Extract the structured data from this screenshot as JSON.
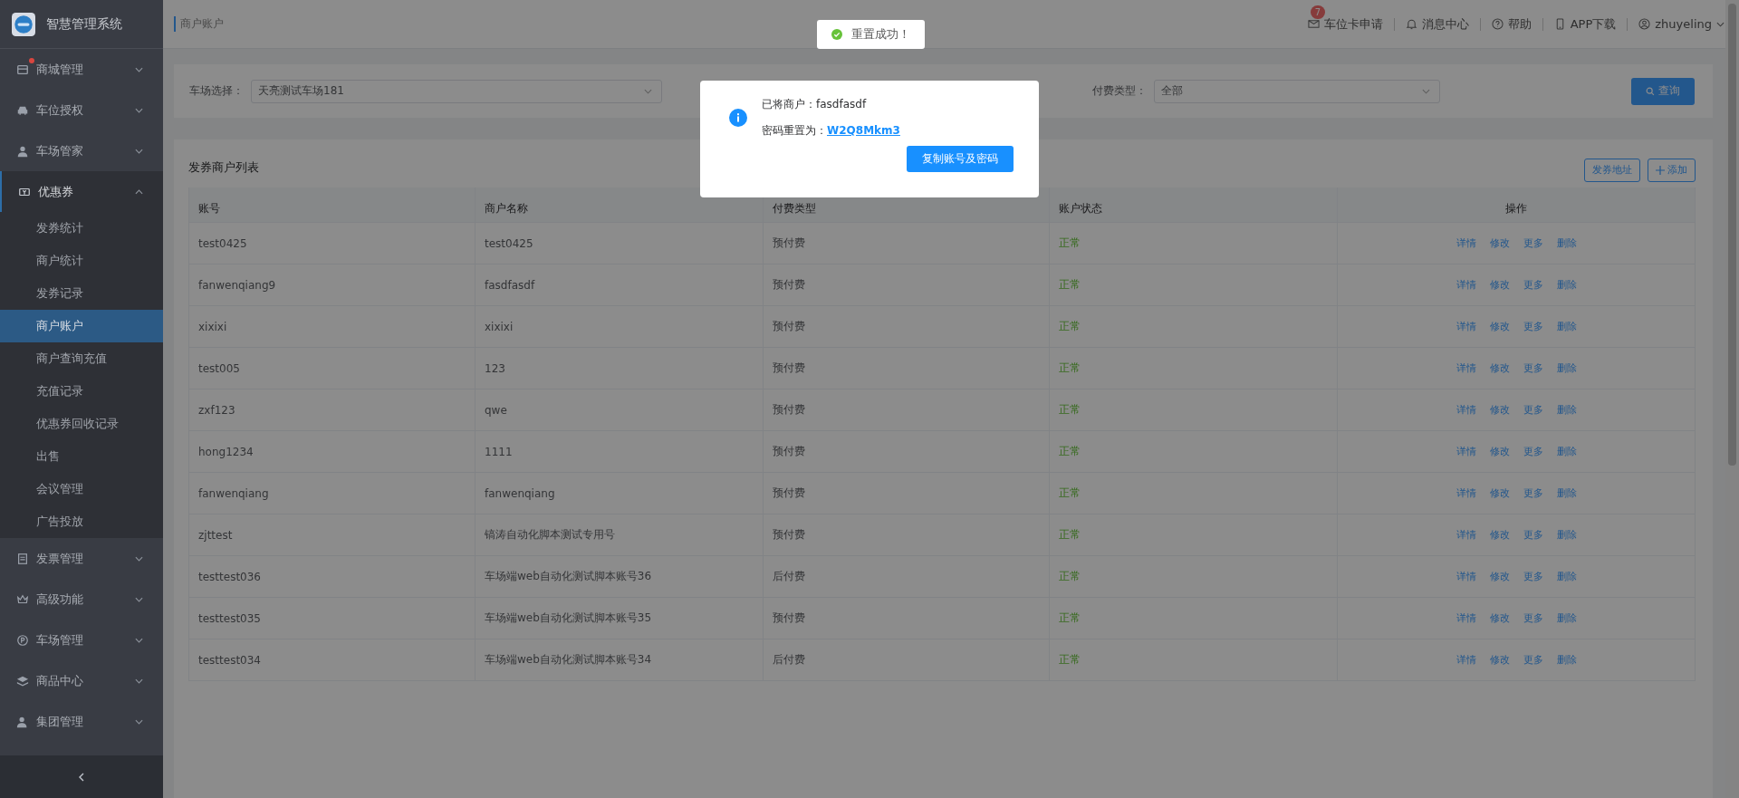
{
  "sidebar": {
    "title": "智慧管理系统",
    "items": [
      {
        "label": "商城管理",
        "dot": true,
        "expanded": false
      },
      {
        "label": "车位授权",
        "dot": false,
        "expanded": false
      },
      {
        "label": "车场管家",
        "dot": false,
        "expanded": false
      },
      {
        "label": "优惠券",
        "dot": false,
        "expanded": true,
        "children": [
          {
            "label": "发券统计",
            "selected": false
          },
          {
            "label": "商户统计",
            "selected": false
          },
          {
            "label": "发券记录",
            "selected": false
          },
          {
            "label": "商户账户",
            "selected": true
          },
          {
            "label": "商户查询充值",
            "selected": false
          },
          {
            "label": "充值记录",
            "selected": false
          },
          {
            "label": "优惠券回收记录",
            "selected": false
          },
          {
            "label": "出售",
            "selected": false
          },
          {
            "label": "会议管理",
            "selected": false
          },
          {
            "label": "广告投放",
            "selected": false
          }
        ]
      },
      {
        "label": "发票管理",
        "dot": false,
        "expanded": false
      },
      {
        "label": "高级功能",
        "dot": false,
        "expanded": false
      },
      {
        "label": "车场管理",
        "dot": false,
        "expanded": false
      },
      {
        "label": "商品中心",
        "dot": false,
        "expanded": false
      },
      {
        "label": "集团管理",
        "dot": false,
        "expanded": false
      }
    ]
  },
  "header": {
    "breadcrumb": "商户账户",
    "nav": [
      {
        "label": "车位卡申请",
        "badge": "7"
      },
      {
        "label": "消息中心"
      },
      {
        "label": "帮助"
      },
      {
        "label": "APP下载"
      },
      {
        "label": "zhuyeling"
      }
    ]
  },
  "toast": {
    "text": "重置成功！"
  },
  "filters": [
    {
      "label": "车场选择：",
      "value": "天亮测试车场181"
    },
    {
      "label": "付费类型：",
      "value": "全部"
    }
  ],
  "query_button": "查询",
  "list": {
    "title": "发券商户列表",
    "buttons": [
      "发券地址",
      "添加"
    ],
    "columns": [
      "账号",
      "商户名称",
      "付费类型",
      "账户状态",
      "操作"
    ],
    "rows": [
      {
        "account": "test0425",
        "name": "test0425",
        "pay_type": "预付费",
        "status": "正常",
        "actions": [
          "详情",
          "修改",
          "更多",
          "删除"
        ]
      },
      {
        "account": "fanwenqiang9",
        "name": "fasdfasdf",
        "pay_type": "预付费",
        "status": "正常",
        "actions": [
          "详情",
          "修改",
          "更多",
          "删除"
        ]
      },
      {
        "account": "xixixi",
        "name": "xixixi",
        "pay_type": "预付费",
        "status": "正常",
        "actions": [
          "详情",
          "修改",
          "更多",
          "删除"
        ]
      },
      {
        "account": "test005",
        "name": "123",
        "pay_type": "预付费",
        "status": "正常",
        "actions": [
          "详情",
          "修改",
          "更多",
          "删除"
        ]
      },
      {
        "account": "zxf123",
        "name": "qwe",
        "pay_type": "预付费",
        "status": "正常",
        "actions": [
          "详情",
          "修改",
          "更多",
          "删除"
        ]
      },
      {
        "account": "hong1234",
        "name": "1111",
        "pay_type": "预付费",
        "status": "正常",
        "actions": [
          "详情",
          "修改",
          "更多",
          "删除"
        ]
      },
      {
        "account": "fanwenqiang",
        "name": "fanwenqiang",
        "pay_type": "预付费",
        "status": "正常",
        "actions": [
          "详情",
          "修改",
          "更多",
          "删除"
        ]
      },
      {
        "account": "zjttest",
        "name": "镐涛自动化脚本测试专用号",
        "pay_type": "预付费",
        "status": "正常",
        "actions": [
          "详情",
          "修改",
          "更多",
          "删除"
        ]
      },
      {
        "account": "testtest036",
        "name": "车场端web自动化测试脚本账号36",
        "pay_type": "后付费",
        "status": "正常",
        "actions": [
          "详情",
          "修改",
          "更多",
          "删除"
        ]
      },
      {
        "account": "testtest035",
        "name": "车场端web自动化测试脚本账号35",
        "pay_type": "预付费",
        "status": "正常",
        "actions": [
          "详情",
          "修改",
          "更多",
          "删除"
        ]
      },
      {
        "account": "testtest034",
        "name": "车场端web自动化测试脚本账号34",
        "pay_type": "后付费",
        "status": "正常",
        "actions": [
          "详情",
          "修改",
          "更多",
          "删除"
        ]
      }
    ]
  },
  "dialog": {
    "message": "已将商户：fasdfasdf",
    "password_label": "密码重置为：",
    "password": "W2Q8Mkm3",
    "button": "复制账号及密码"
  }
}
